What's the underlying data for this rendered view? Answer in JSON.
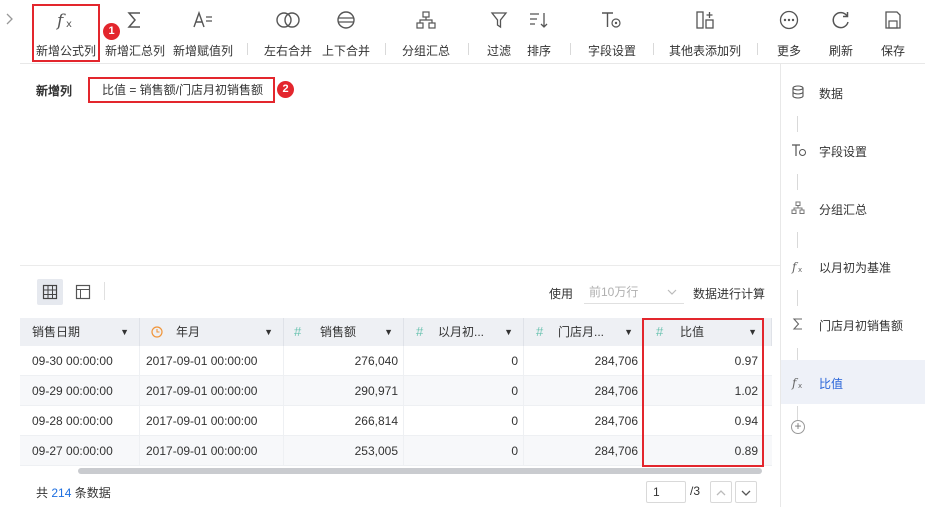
{
  "toolbar": {
    "add_formula": "新增公式列",
    "add_summary": "新增汇总列",
    "add_assign": "新增赋值列",
    "merge_lr": "左右合并",
    "merge_ud": "上下合并",
    "group_summary": "分组汇总",
    "filter": "过滤",
    "sort": "排序",
    "field_settings": "字段设置",
    "add_other_table": "其他表添加列",
    "more": "更多",
    "refresh": "刷新",
    "save": "保存"
  },
  "markers": {
    "m1": "1",
    "m2": "2"
  },
  "formula": {
    "label": "新增列",
    "value": "比值 = 销售额/门店月初销售额"
  },
  "compute": {
    "use_label": "使用",
    "rows_option": "前10万行",
    "suffix": "数据进行计算"
  },
  "table": {
    "columns": [
      {
        "name": "销售日期"
      },
      {
        "name": "年月"
      },
      {
        "name": "销售额"
      },
      {
        "name": "以月初..."
      },
      {
        "name": "门店月..."
      },
      {
        "name": "比值"
      }
    ],
    "rows": [
      [
        "09-30 00:00:00",
        "2017-09-01 00:00:00",
        "276,040",
        "0",
        "284,706",
        "0.97"
      ],
      [
        "09-29 00:00:00",
        "2017-09-01 00:00:00",
        "290,971",
        "0",
        "284,706",
        "1.02"
      ],
      [
        "09-28 00:00:00",
        "2017-09-01 00:00:00",
        "266,814",
        "0",
        "284,706",
        "0.94"
      ],
      [
        "09-27 00:00:00",
        "2017-09-01 00:00:00",
        "253,005",
        "0",
        "284,706",
        "0.89"
      ]
    ]
  },
  "footer": {
    "total_prefix": "共",
    "total_count": "214",
    "total_suffix": "条数据",
    "page_value": "1",
    "page_total": "/3"
  },
  "right_panel": {
    "items": [
      {
        "label": "数据",
        "icon": "database-icon"
      },
      {
        "label": "字段设置",
        "icon": "field-settings-icon"
      },
      {
        "label": "分组汇总",
        "icon": "group-icon"
      },
      {
        "label": "以月初为基准",
        "icon": "formula-icon"
      },
      {
        "label": "门店月初销售额",
        "icon": "sigma-icon"
      },
      {
        "label": "比值",
        "icon": "formula-icon"
      }
    ]
  },
  "colors": {
    "accent": "#2663d8",
    "highlight": "#e3262d",
    "field_icon": "#6bc3b1"
  }
}
